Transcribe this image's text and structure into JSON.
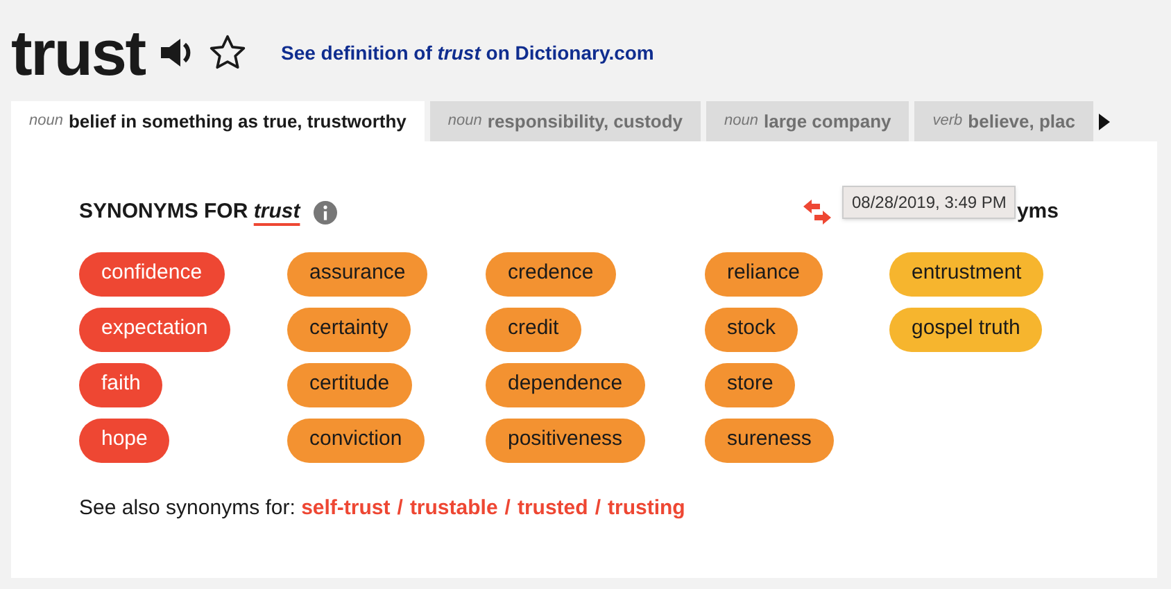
{
  "word": "trust",
  "definition_link": {
    "before": "See definition of ",
    "word": "trust",
    "after": " on Dictionary.com"
  },
  "tabs": [
    {
      "pos": "noun",
      "label": "belief in something as true, trustworthy",
      "selected": true
    },
    {
      "pos": "noun",
      "label": "responsibility, custody",
      "selected": false
    },
    {
      "pos": "noun",
      "label": "large company",
      "selected": false
    },
    {
      "pos": "verb",
      "label": "believe, plac",
      "selected": false
    }
  ],
  "heading": {
    "prefix": "SYNONYMS FOR ",
    "word": "trust"
  },
  "compare": {
    "label": "yms",
    "tooltip": "08/28/2019, 3:49 PM"
  },
  "columns": [
    [
      {
        "text": "confidence",
        "color": "#ee4733"
      },
      {
        "text": "expectation",
        "color": "#ee4733"
      },
      {
        "text": "faith",
        "color": "#ee4733"
      },
      {
        "text": "hope",
        "color": "#ee4733"
      }
    ],
    [
      {
        "text": "assurance",
        "color": "#f39231"
      },
      {
        "text": "certainty",
        "color": "#f39231"
      },
      {
        "text": "certitude",
        "color": "#f39231"
      },
      {
        "text": "conviction",
        "color": "#f39231"
      }
    ],
    [
      {
        "text": "credence",
        "color": "#f39231"
      },
      {
        "text": "credit",
        "color": "#f39231"
      },
      {
        "text": "dependence",
        "color": "#f39231"
      },
      {
        "text": "positiveness",
        "color": "#f39231"
      }
    ],
    [
      {
        "text": "reliance",
        "color": "#f39231"
      },
      {
        "text": "stock",
        "color": "#f39231"
      },
      {
        "text": "store",
        "color": "#f39231"
      },
      {
        "text": "sureness",
        "color": "#f39231"
      }
    ],
    [
      {
        "text": "entrustment",
        "color": "#f6b52e"
      },
      {
        "text": "gospel truth",
        "color": "#f6b52e"
      }
    ]
  ],
  "see_also": {
    "label": "See also synonyms for: ",
    "links": [
      "self-trust",
      "trustable",
      "trusted",
      "trusting"
    ],
    "separator": "/"
  }
}
